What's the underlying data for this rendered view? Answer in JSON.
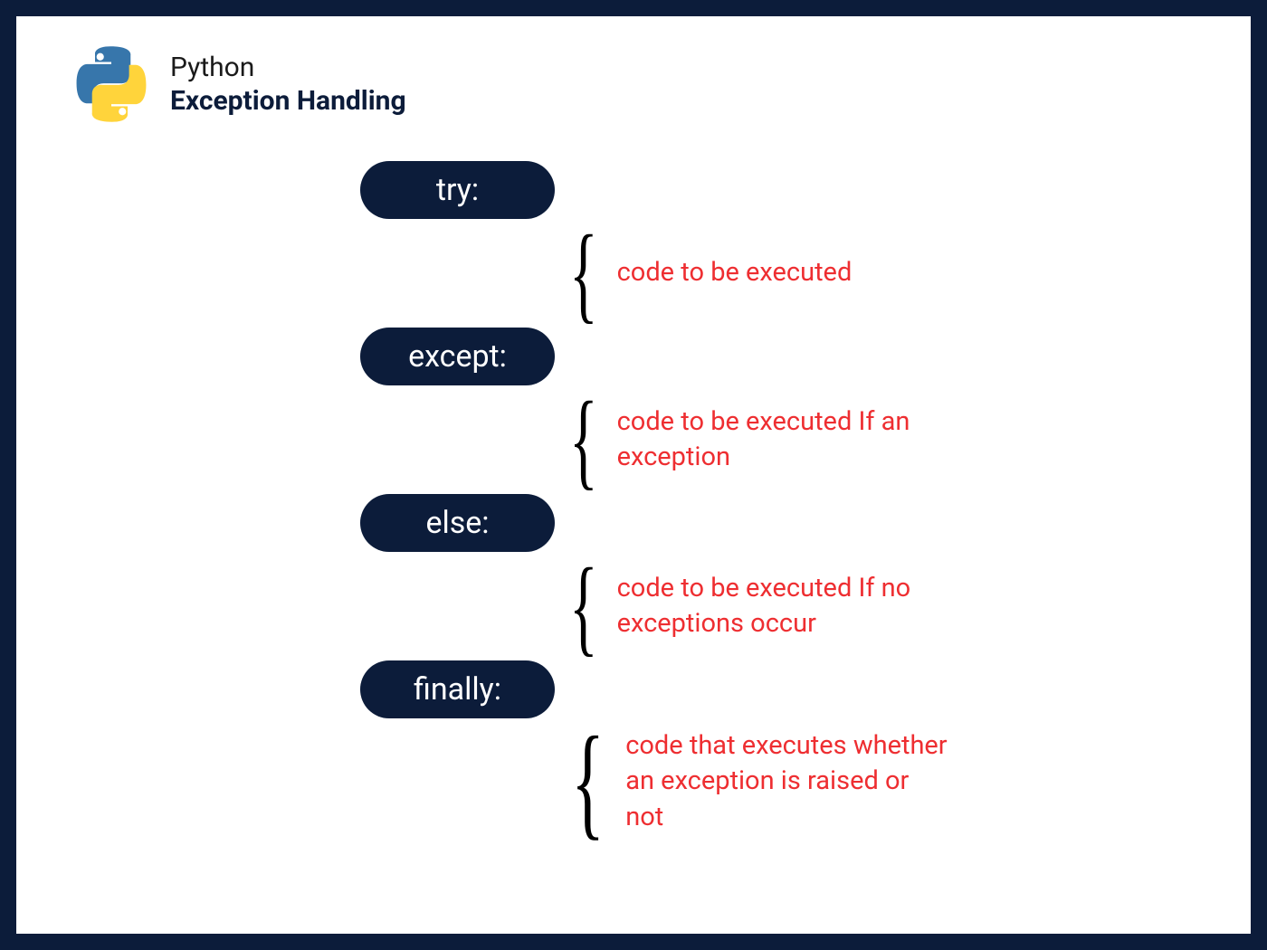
{
  "header": {
    "subtitle": "Python",
    "title": "Exception Handling"
  },
  "blocks": [
    {
      "keyword": "try:",
      "description": "code to be executed"
    },
    {
      "keyword": "except:",
      "description": "code to be executed If an exception"
    },
    {
      "keyword": "else:",
      "description": "code to be executed If no exceptions occur"
    },
    {
      "keyword": "finally:",
      "description": "code that executes whether an exception is raised or not"
    }
  ]
}
